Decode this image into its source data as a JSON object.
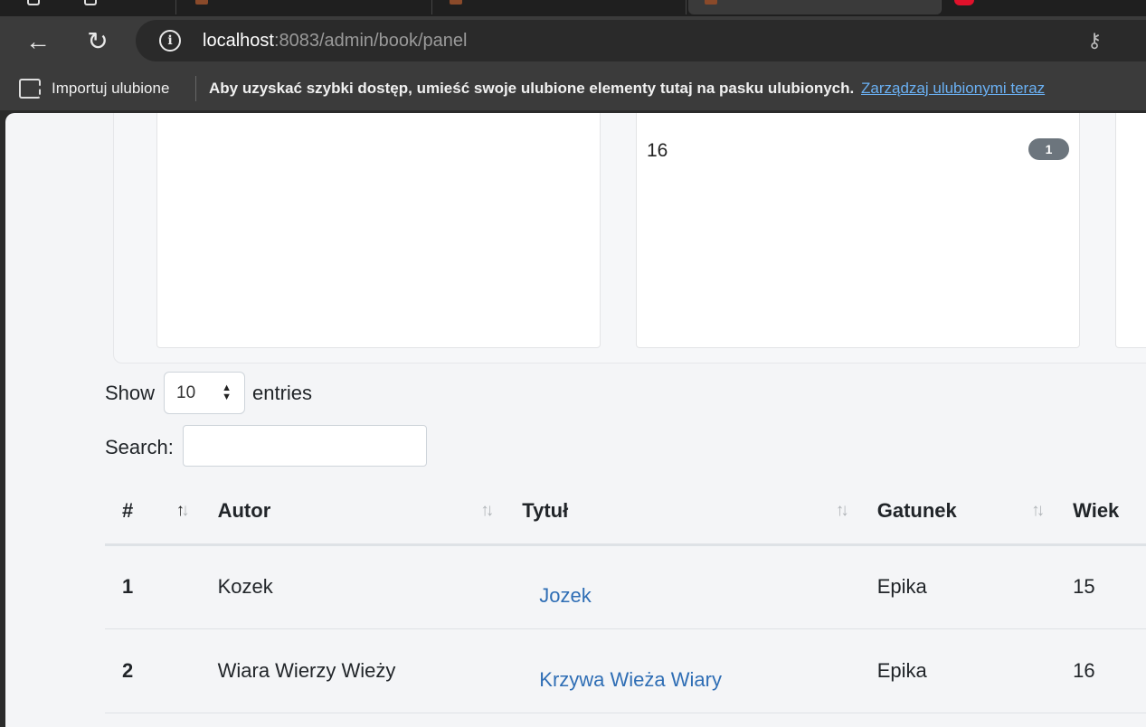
{
  "browser": {
    "url_host": "localhost",
    "url_rest": ":8083/admin/book/panel",
    "favorites": {
      "import_label": "Importuj ulubione",
      "hint": "Aby uzyskać szybki dostęp, umieść swoje ulubione elementy tutaj na pasku ulubionych.",
      "manage_link": "Zarządzaj ulubionymi teraz"
    }
  },
  "cards": [
    {
      "rows": []
    },
    {
      "rows": [
        {
          "label": "16",
          "count": "1"
        }
      ]
    },
    {
      "rows": []
    }
  ],
  "datatable": {
    "show_label": "Show",
    "entries_value": "10",
    "entries_label": "entries",
    "search_label": "Search:",
    "search_value": "",
    "columns": [
      "#",
      "Autor",
      "Tytuł",
      "Gatunek",
      "Wiek"
    ],
    "rows": [
      {
        "idx": "1",
        "autor": "Kozek",
        "tytul": "Jozek",
        "gatunek": "Epika",
        "wiek": "15"
      },
      {
        "idx": "2",
        "autor": "Wiara Wierzy Wieży",
        "tytul": "Krzywa Wieża Wiary",
        "gatunek": "Epika",
        "wiek": "16"
      }
    ]
  },
  "colors": {
    "badge": "#6c757d",
    "link": "#2f6eb5",
    "page_bg": "#f4f5f7"
  }
}
